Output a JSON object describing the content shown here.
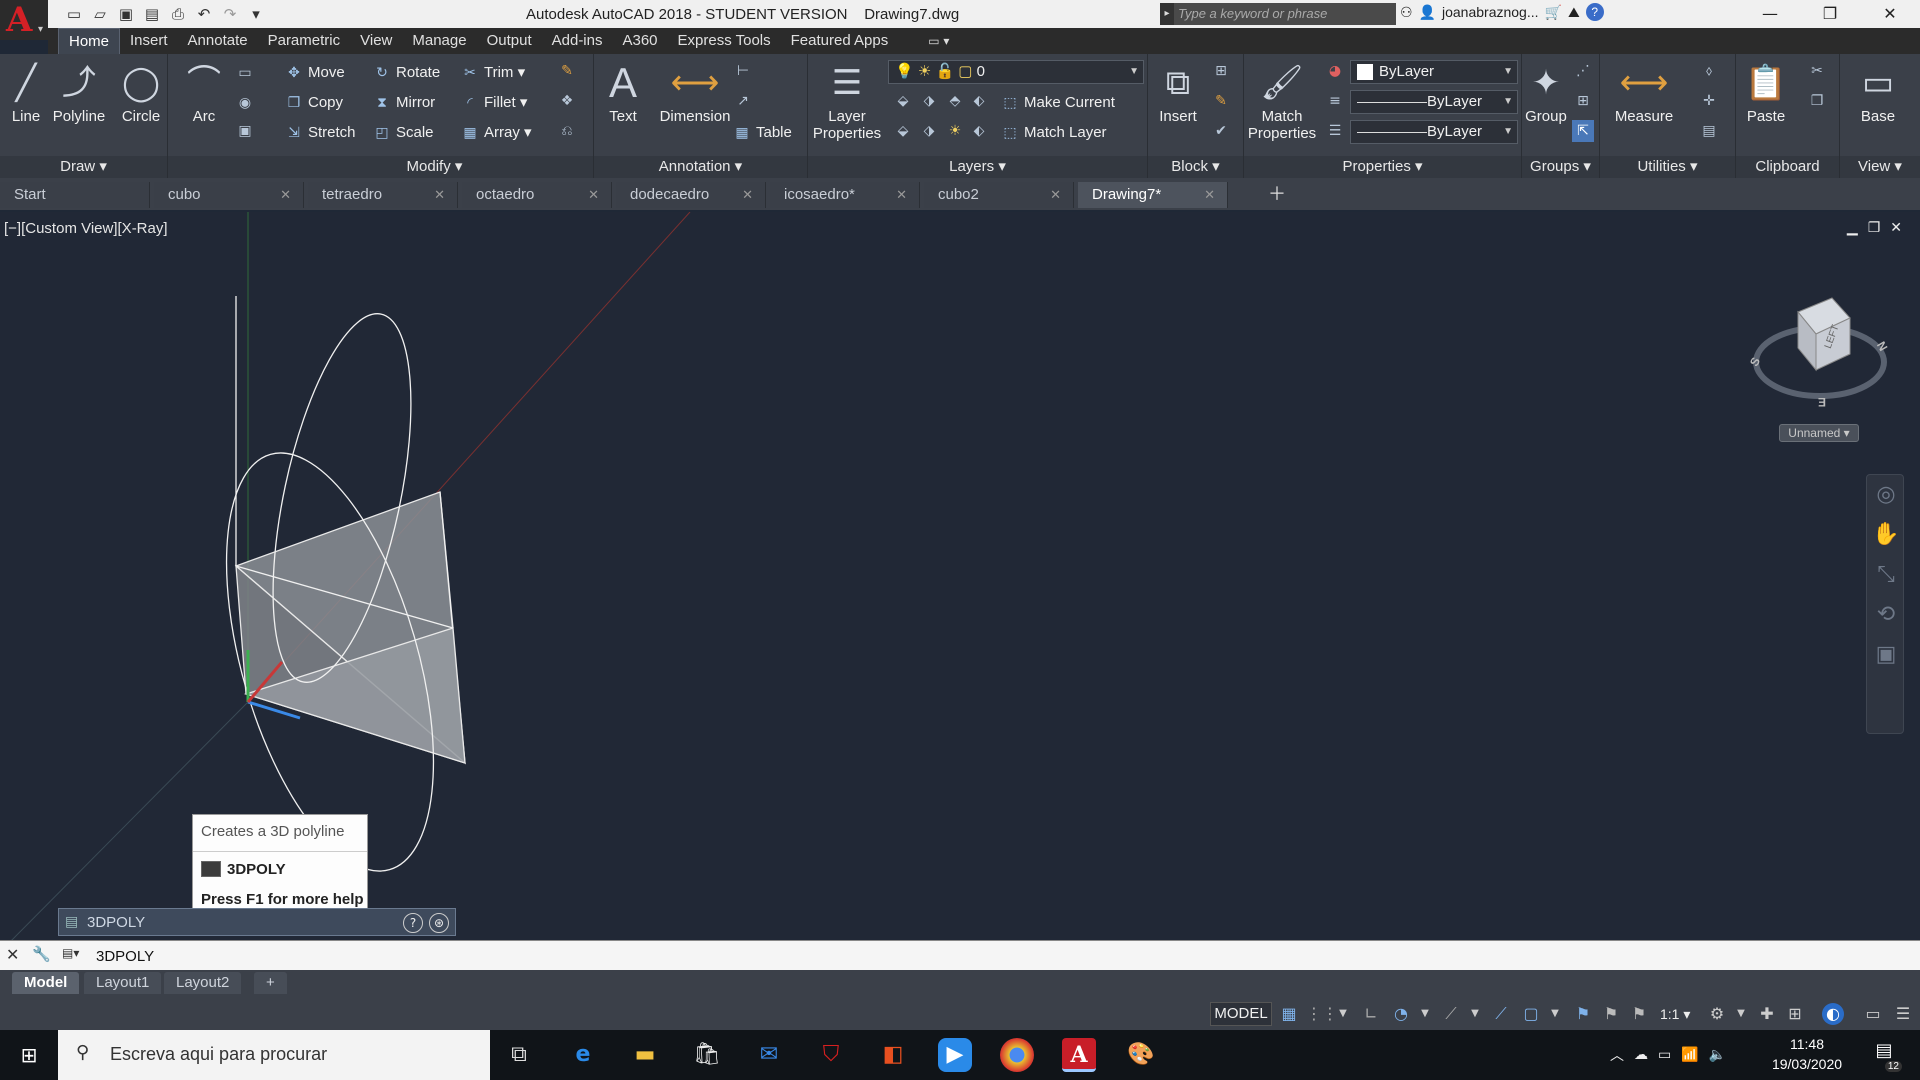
{
  "app": {
    "title": "Autodesk AutoCAD 2018 - STUDENT VERSION    Drawing7.dwg",
    "logo_letter": "A",
    "search_placeholder": "Type a keyword or phrase",
    "user": "joanabraznog...",
    "help_icon": "?"
  },
  "ribbon_tabs": [
    "Home",
    "Insert",
    "Annotate",
    "Parametric",
    "View",
    "Manage",
    "Output",
    "Add-ins",
    "A360",
    "Express Tools",
    "Featured Apps"
  ],
  "ribbon": {
    "draw": {
      "title": "Draw",
      "line": "Line",
      "polyline": "Polyline",
      "circle": "Circle",
      "arc": "Arc"
    },
    "modify": {
      "title": "Modify",
      "move": "Move",
      "rotate": "Rotate",
      "trim": "Trim",
      "copy": "Copy",
      "mirror": "Mirror",
      "fillet": "Fillet",
      "stretch": "Stretch",
      "scale": "Scale",
      "array": "Array"
    },
    "annotation": {
      "title": "Annotation",
      "text": "Text",
      "dimension": "Dimension",
      "table": "Table"
    },
    "layers": {
      "title": "Layers",
      "layer_properties_1": "Layer",
      "layer_properties_2": "Properties",
      "current_layer": "0",
      "make_current": "Make Current",
      "match_layer": "Match Layer"
    },
    "block": {
      "title": "Block",
      "insert": "Insert"
    },
    "properties": {
      "title": "Properties",
      "match_1": "Match",
      "match_2": "Properties",
      "color": "ByLayer",
      "linetype": "ByLayer",
      "lineweight": "ByLayer"
    },
    "groups": {
      "title": "Groups",
      "group": "Group"
    },
    "utilities": {
      "title": "Utilities",
      "measure": "Measure"
    },
    "clipboard": {
      "title": "Clipboard",
      "paste": "Paste"
    },
    "view": {
      "title": "View",
      "base": "Base"
    }
  },
  "doc_tabs": [
    {
      "label": "Start",
      "closable": false
    },
    {
      "label": "cubo",
      "closable": true
    },
    {
      "label": "tetraedro",
      "closable": true
    },
    {
      "label": "octaedro",
      "closable": true
    },
    {
      "label": "dodecaedro",
      "closable": true
    },
    {
      "label": "icosaedro*",
      "closable": true
    },
    {
      "label": "cubo2",
      "closable": true
    },
    {
      "label": "Drawing7*",
      "closable": true,
      "active": true
    }
  ],
  "viewport": {
    "label": "[−][Custom View][X-Ray]",
    "viewcube": {
      "face": "LEFT",
      "south": "S",
      "north": "N",
      "east": "E",
      "ucs_name": "Unnamed"
    }
  },
  "tooltip": {
    "description": "Creates a 3D polyline",
    "command": "3DPOLY",
    "help": "Press F1 for more help"
  },
  "command_float": {
    "text": "3DPOLY"
  },
  "command_line": {
    "value": "3DPOLY"
  },
  "layout_tabs": [
    "Model",
    "Layout1",
    "Layout2"
  ],
  "status_bar": {
    "model": "MODEL",
    "scale": "1:1"
  },
  "taskbar": {
    "search_text": "Escreva aqui para procurar",
    "time": "11:48",
    "date": "19/03/2020",
    "notifications": "12"
  },
  "colors": {
    "viewport_bg": "#212836",
    "ribbon_bg": "#3b4049",
    "accent_red": "#d42026",
    "face_fill": "#8b8f95"
  }
}
